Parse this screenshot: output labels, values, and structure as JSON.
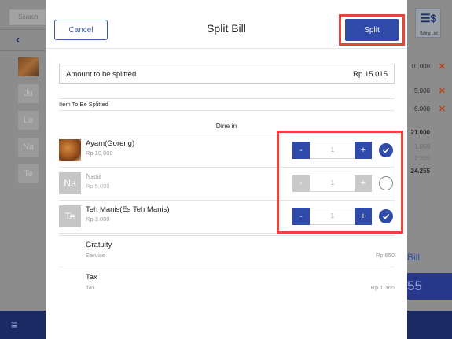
{
  "background": {
    "search_placeholder": "Search",
    "thumbs": [
      "Ju",
      "Le",
      "Na",
      "Te"
    ],
    "billing_label": "Billing List",
    "amounts": [
      "10.000",
      "5.000",
      "6.000"
    ],
    "subtotal": "21.000",
    "sub_lines": [
      "1.050",
      "2.205"
    ],
    "grand_total": "24.255",
    "bill_label": "Bill",
    "total_fragment": "55"
  },
  "modal": {
    "title": "Split Bill",
    "cancel_label": "Cancel",
    "split_label": "Split",
    "amount_label": "Amount to be splitted",
    "amount_value": "Rp 15.015",
    "section_label": "Item To Be Splitted",
    "group_label": "Dine in",
    "items": [
      {
        "thumb": "",
        "name": "Ayam(Goreng)",
        "price": "Rp 10.000",
        "qty": "1",
        "selected": true
      },
      {
        "thumb": "Na",
        "name": "Nasi",
        "price": "Rp 5.000",
        "qty": "1",
        "selected": false
      },
      {
        "thumb": "Te",
        "name": "Teh Manis(Es Teh Manis)",
        "price": "Rp 3.000",
        "qty": "1",
        "selected": true
      }
    ],
    "fees": [
      {
        "name": "Gratuity",
        "sub": "Service",
        "value": "Rp 650"
      },
      {
        "name": "Tax",
        "sub": "Tax",
        "value": "Rp 1.365"
      }
    ],
    "minus_symbol": "-",
    "plus_symbol": "+"
  },
  "colors": {
    "primary": "#2f4aa8",
    "highlight": "#e8443a",
    "navy": "#1c2a64"
  }
}
